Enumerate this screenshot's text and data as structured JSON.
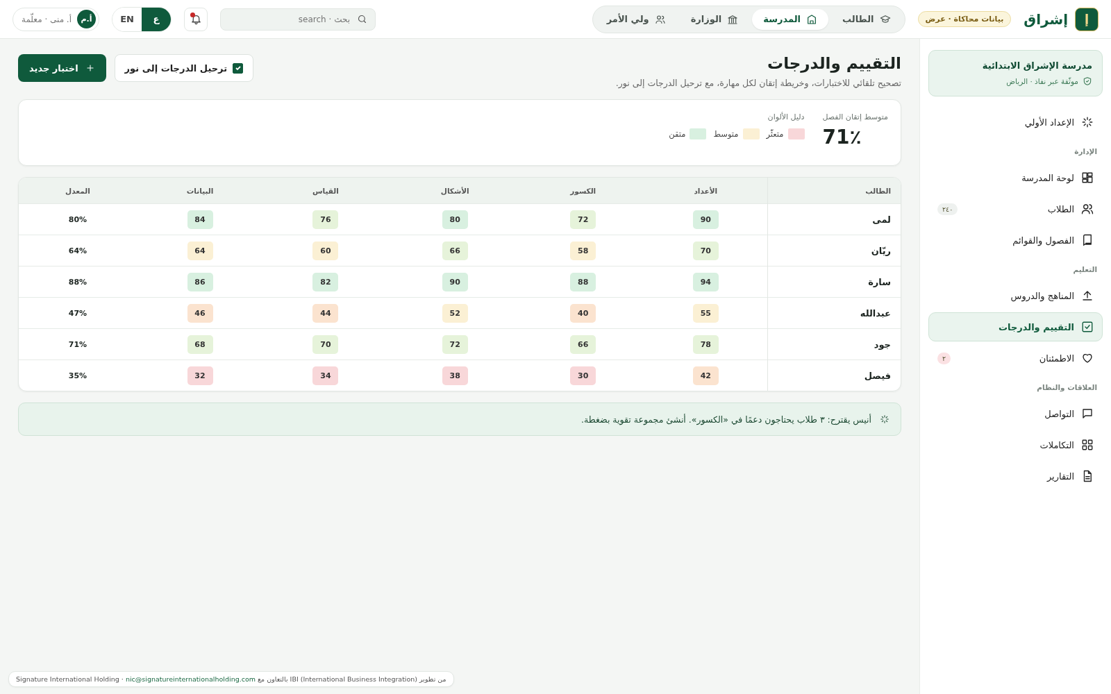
{
  "brand": {
    "logo": "إ",
    "name": "إشراق",
    "badge": "بيانات محاكاة · عرض"
  },
  "role_tabs": [
    {
      "label": "الطالب",
      "selected": false
    },
    {
      "label": "المدرسة",
      "selected": true
    },
    {
      "label": "الوزارة",
      "selected": false
    },
    {
      "label": "ولي الأمر",
      "selected": false
    }
  ],
  "search": {
    "placeholder": "بحث · search"
  },
  "notifications": {
    "unread": true
  },
  "language": [
    {
      "label": "ع",
      "selected": true
    },
    {
      "label": "EN",
      "selected": false
    }
  ],
  "user": {
    "initials": "أ.م",
    "name": "أ. منى · معلّمة"
  },
  "sidebar": {
    "school": {
      "name": "مدرسة الإشراق الابتدائية",
      "verified": "موثّقة عبر نفاذ · الرياض"
    },
    "items": [
      {
        "kind": "item",
        "label": "الإعداد الأولي",
        "selected": false
      },
      {
        "kind": "section",
        "label": "الإدارة"
      },
      {
        "kind": "item",
        "label": "لوحة المدرسة",
        "selected": false
      },
      {
        "kind": "item",
        "label": "الطلاب",
        "selected": false,
        "badge": {
          "text": "٢٤٠",
          "color": "#eef1ef"
        }
      },
      {
        "kind": "item",
        "label": "الفصول والقوائم",
        "selected": false
      },
      {
        "kind": "section",
        "label": "التعليم"
      },
      {
        "kind": "item",
        "label": "المناهج والدروس",
        "selected": false
      },
      {
        "kind": "item",
        "label": "التقييم والدرجات",
        "selected": true
      },
      {
        "kind": "item",
        "label": "الاطمئنان",
        "selected": false,
        "badge": {
          "text": "٢",
          "color": "#fbe1e3"
        }
      },
      {
        "kind": "section",
        "label": "العلاقات والنظام"
      },
      {
        "kind": "item",
        "label": "التواصل",
        "selected": false
      },
      {
        "kind": "item",
        "label": "التكاملات",
        "selected": false
      },
      {
        "kind": "item",
        "label": "التقارير",
        "selected": false
      }
    ]
  },
  "page": {
    "title": "التقييم والدرجات",
    "subtitle": "تصحيح تلقائي للاختبارات، وخريطة إتقان لكل مهارة، مع ترحيل الدرجات إلى نور.",
    "sync": {
      "label": "ترحيل الدرجات إلى نور",
      "checked": true
    },
    "new_test": "اختبار جديد"
  },
  "summary": {
    "label": "متوسط إتقان الفصل",
    "value": "71٪",
    "legend_title": "دليل الألوان",
    "legend": [
      {
        "label": "متعثّر",
        "color": "#f8d7d9"
      },
      {
        "label": "متوسط",
        "color": "#fbf0d4"
      },
      {
        "label": "متقن",
        "color": "#d8f0e0"
      }
    ]
  },
  "table": {
    "columns": [
      "الطالب",
      "الأعداد",
      "الكسور",
      "الأشكال",
      "القياس",
      "البيانات",
      "المعدل"
    ],
    "rows": [
      {
        "student": "لمى",
        "average": "80%",
        "scores": [
          {
            "value": "90",
            "color": "#d8f0e0"
          },
          {
            "value": "72",
            "color": "#e6f3da"
          },
          {
            "value": "80",
            "color": "#d8f0e0"
          },
          {
            "value": "76",
            "color": "#e6f3da"
          },
          {
            "value": "84",
            "color": "#d8f0e0"
          }
        ]
      },
      {
        "student": "ريّان",
        "average": "64%",
        "scores": [
          {
            "value": "70",
            "color": "#e6f3da"
          },
          {
            "value": "58",
            "color": "#fbf0d4"
          },
          {
            "value": "66",
            "color": "#e6f3da"
          },
          {
            "value": "60",
            "color": "#fbf0d4"
          },
          {
            "value": "64",
            "color": "#fbf0d4"
          }
        ]
      },
      {
        "student": "سارة",
        "average": "88%",
        "scores": [
          {
            "value": "94",
            "color": "#d8f0e0"
          },
          {
            "value": "88",
            "color": "#d8f0e0"
          },
          {
            "value": "90",
            "color": "#d8f0e0"
          },
          {
            "value": "82",
            "color": "#d8f0e0"
          },
          {
            "value": "86",
            "color": "#d8f0e0"
          }
        ]
      },
      {
        "student": "عبدالله",
        "average": "47%",
        "scores": [
          {
            "value": "55",
            "color": "#fbf0d4"
          },
          {
            "value": "40",
            "color": "#fbe3cf"
          },
          {
            "value": "52",
            "color": "#fbf0d4"
          },
          {
            "value": "44",
            "color": "#fbe3cf"
          },
          {
            "value": "46",
            "color": "#fbe3cf"
          }
        ]
      },
      {
        "student": "جود",
        "average": "71%",
        "scores": [
          {
            "value": "78",
            "color": "#e6f3da"
          },
          {
            "value": "66",
            "color": "#e6f3da"
          },
          {
            "value": "72",
            "color": "#e6f3da"
          },
          {
            "value": "70",
            "color": "#e6f3da"
          },
          {
            "value": "68",
            "color": "#e6f3da"
          }
        ]
      },
      {
        "student": "فيصل",
        "average": "35%",
        "scores": [
          {
            "value": "42",
            "color": "#fbe3cf"
          },
          {
            "value": "30",
            "color": "#f8d7d9"
          },
          {
            "value": "38",
            "color": "#f8d7d9"
          },
          {
            "value": "34",
            "color": "#f8d7d9"
          },
          {
            "value": "32",
            "color": "#f8d7d9"
          }
        ]
      }
    ]
  },
  "suggestion": "أنيس يقترح: ٣ طلاب يحتاجون دعمًا في «الكسور». أنشئ مجموعة تقوية بضغطة.",
  "footer": {
    "before": "من تطوير IBI (International Business Integration) بالتعاون مع",
    "link": "nic@signatureinternationalholding.com",
    "after": "· Signature International Holding"
  }
}
